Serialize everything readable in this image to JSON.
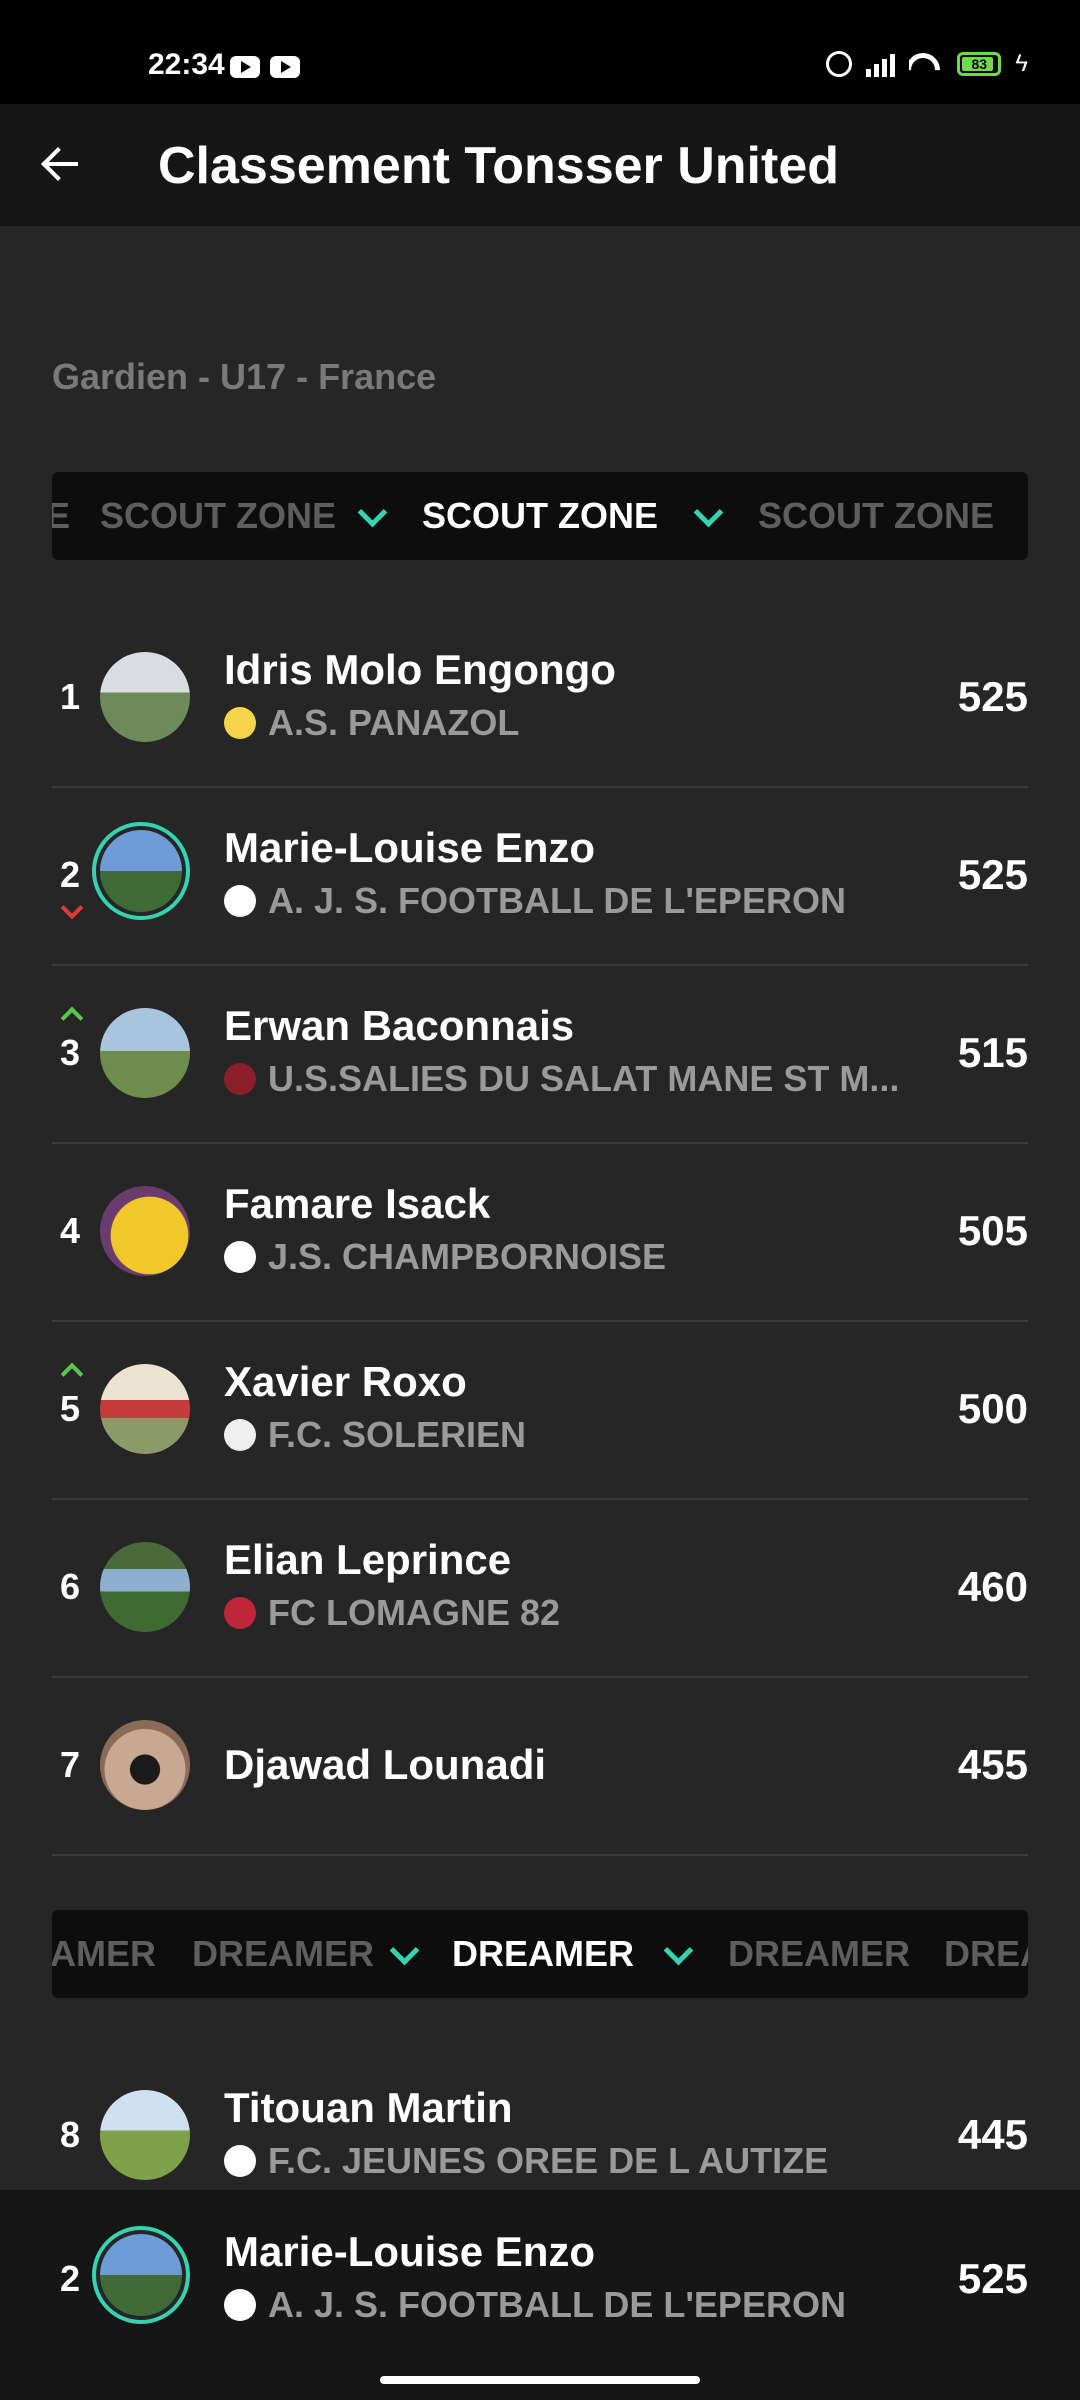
{
  "status_bar": {
    "time": "22:34",
    "battery": "83",
    "colors": {
      "battery": "#6ddc4a"
    }
  },
  "app_bar": {
    "title": "Classement Tonsser United"
  },
  "subtitle": "Gardien - U17 - France",
  "zones": [
    {
      "items": [
        "E",
        "SCOUT ZONE",
        "SCOUT ZONE",
        "SCOUT ZONE"
      ],
      "active_index": 2
    },
    {
      "items": [
        "AMER",
        "DREAMER",
        "DREAMER",
        "DREAMER",
        "DREA"
      ],
      "active_index": 2
    }
  ],
  "players": [
    {
      "rank": "1",
      "name": "Idris Molo Engongo",
      "club": "A.S. PANAZOL",
      "score": "525",
      "trend": "none"
    },
    {
      "rank": "2",
      "name": "Marie-Louise Enzo",
      "club": "A. J. S. FOOTBALL DE L'EPERON",
      "score": "525",
      "trend": "down",
      "highlight": true
    },
    {
      "rank": "3",
      "name": "Erwan Baconnais",
      "club": "U.S.SALIES DU SALAT MANE ST M...",
      "score": "515",
      "trend": "up"
    },
    {
      "rank": "4",
      "name": "Famare Isack",
      "club": "J.S. CHAMPBORNOISE",
      "score": "505",
      "trend": "none"
    },
    {
      "rank": "5",
      "name": "Xavier Roxo",
      "club": "F.C. SOLERIEN",
      "score": "500",
      "trend": "up"
    },
    {
      "rank": "6",
      "name": "Elian Leprince",
      "club": "FC LOMAGNE 82",
      "score": "460",
      "trend": "none"
    },
    {
      "rank": "7",
      "name": "Djawad Lounadi",
      "club": "",
      "score": "455",
      "trend": "none"
    },
    {
      "rank": "8",
      "name": "Titouan Martin",
      "club": "F.C. JEUNES OREE DE L AUTIZE",
      "score": "445",
      "trend": "none"
    }
  ],
  "current_user": {
    "rank": "2",
    "name": "Marie-Louise Enzo",
    "club": "A. J. S. FOOTBALL DE L'EPERON",
    "score": "525"
  },
  "colors": {
    "accent": "#35d3b2",
    "trend_up": "#58c84a",
    "trend_down": "#e23b3b",
    "background": "#262626"
  }
}
